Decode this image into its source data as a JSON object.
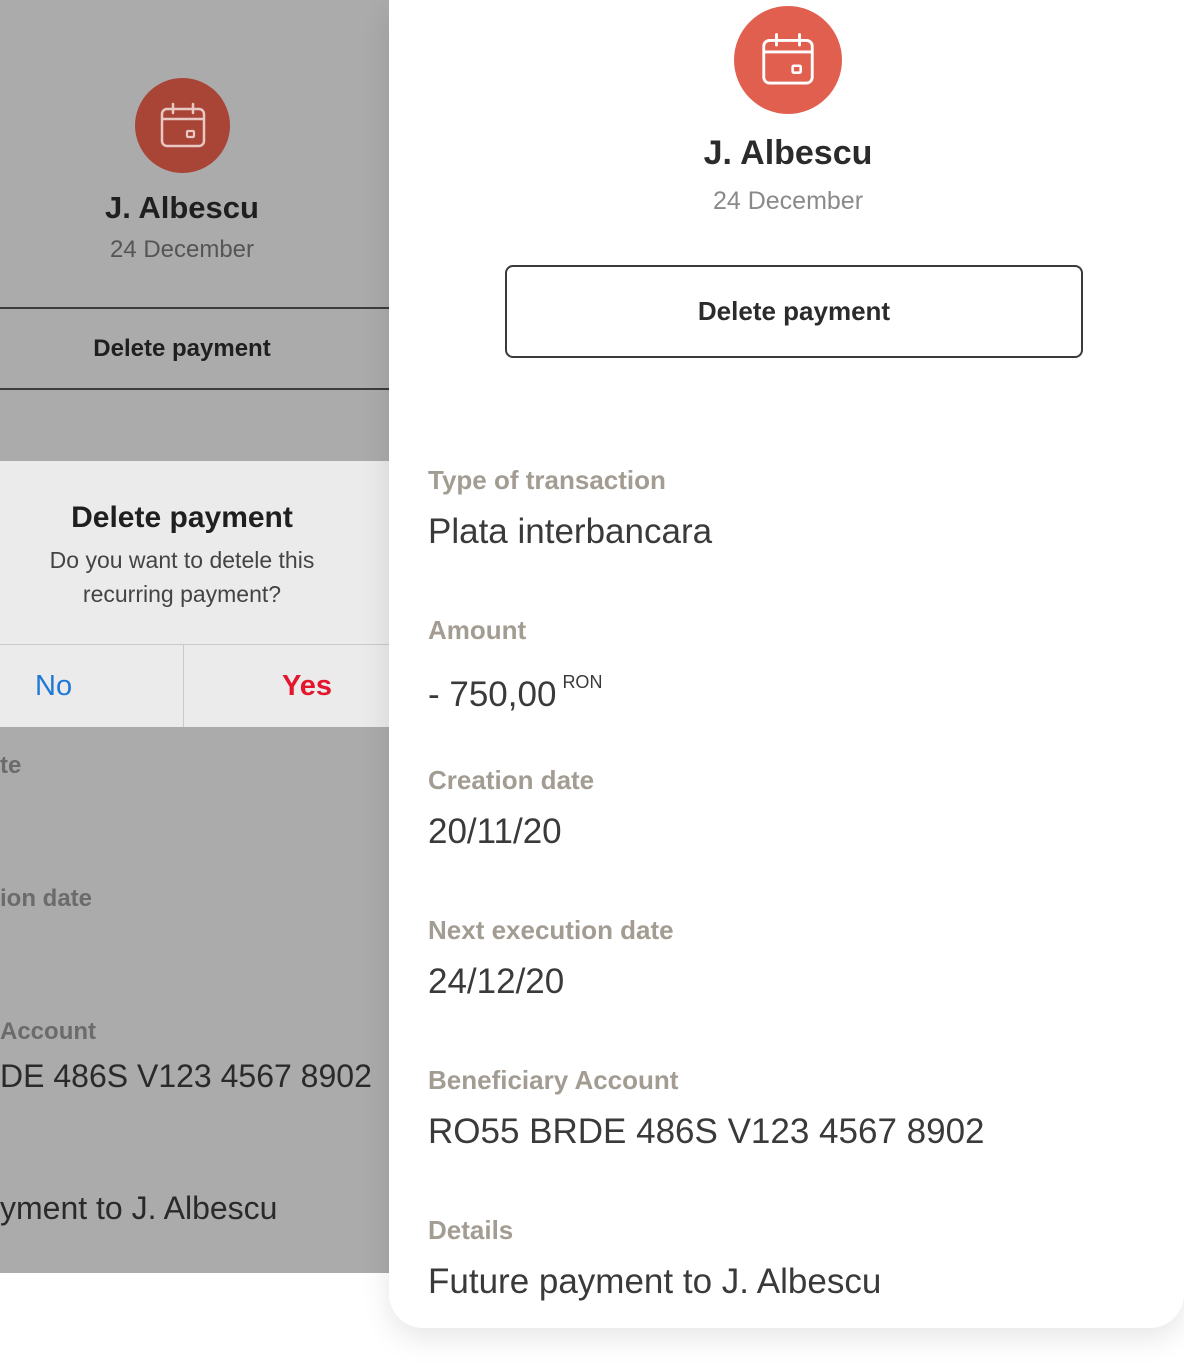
{
  "background_screen": {
    "contact_name": "J. Albescu",
    "date": "24 December",
    "delete_button_label": "Delete payment",
    "fragments": [
      {
        "kind": "label",
        "text": "te"
      },
      {
        "kind": "label",
        "text": "ion date"
      },
      {
        "kind": "label",
        "text": "Account"
      },
      {
        "kind": "value",
        "text": "DE 486S V123 4567 8902"
      },
      {
        "kind": "value",
        "text": "yment to J. Albescu"
      }
    ],
    "dialog": {
      "title": "Delete payment",
      "message": "Do you want to detele this recurring payment?",
      "no_label": "No",
      "yes_label": "Yes"
    }
  },
  "card": {
    "icon": "calendar-icon",
    "contact_name": "J. Albescu",
    "date": "24 December",
    "delete_button_label": "Delete payment",
    "fields": [
      {
        "label": "Type of transaction",
        "value": "Plata interbancara"
      },
      {
        "label": "Amount",
        "value": "- 750,00",
        "currency": "RON"
      },
      {
        "label": "Creation date",
        "value": "20/11/20"
      },
      {
        "label": "Next execution date",
        "value": "24/12/20"
      },
      {
        "label": "Beneficiary Account",
        "value": "RO55 BRDE 486S V123 4567 8902"
      },
      {
        "label": "Details",
        "value": "Future payment to J. Albescu"
      }
    ]
  },
  "colors": {
    "avatar": "#e05f4e",
    "avatar_dimmed": "#a84536",
    "label": "#a29c92",
    "no_button": "#1e78d6",
    "yes_button": "#e4162d"
  }
}
